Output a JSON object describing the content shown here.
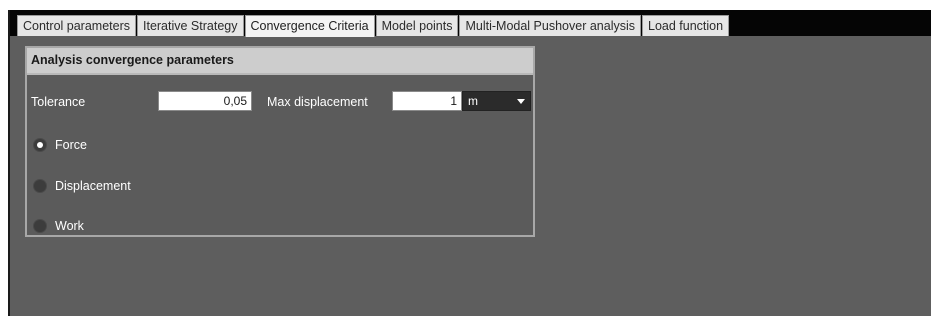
{
  "tabs": [
    {
      "label": "Control parameters",
      "active": false
    },
    {
      "label": "Iterative Strategy",
      "active": false
    },
    {
      "label": "Convergence Criteria",
      "active": true
    },
    {
      "label": "Model points",
      "active": false
    },
    {
      "label": "Multi-Modal Pushover analysis",
      "active": false
    },
    {
      "label": "Load function",
      "active": false
    }
  ],
  "panel": {
    "title": "Analysis convergence parameters",
    "tolerance_label": "Tolerance",
    "tolerance_value": "0,05",
    "max_displacement_label": "Max displacement",
    "max_displacement_value": "1",
    "unit_value": "m",
    "radio_options": [
      {
        "label": "Force",
        "checked": true
      },
      {
        "label": "Displacement",
        "checked": false
      },
      {
        "label": "Work",
        "checked": false
      }
    ]
  },
  "colors": {
    "background": "#5e5e5e",
    "tab_bar": "#050505",
    "panel_header": "#cdcdcd",
    "panel_border": "#a8a8a8"
  }
}
